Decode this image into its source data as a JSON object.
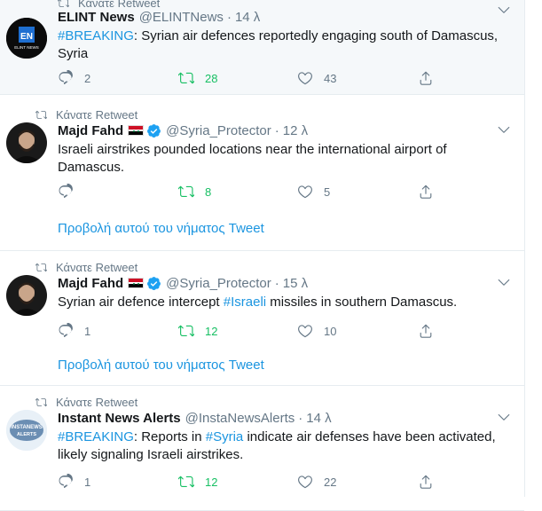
{
  "retweet_label": "Κάνατε Retweet",
  "show_thread": "Προβολή αυτού του νήματος Tweet",
  "dot": "·",
  "colors": {
    "link": "#1b95e0",
    "retweet_green": "#17bf63",
    "muted": "#657786",
    "text": "#14171a",
    "verified": "#1da1f2"
  },
  "tweets": [
    {
      "retweeted": "Κάνατε Retweet",
      "name": "ELINT News",
      "handle": "@ELINTNews",
      "time": "14 λ",
      "hashtag": "#BREAKING",
      "text_after": ": Syrian air defences reportedly engaging south of Damascus, Syria",
      "replies": "2",
      "retweets": "28",
      "likes": "43",
      "avatar_text": "EN",
      "avatar_sub": "ELINT NEWS"
    },
    {
      "retweeted": "Κάνατε Retweet",
      "name": "Majd Fahd",
      "handle": "@Syria_Protector",
      "time": "12 λ",
      "text": "Israeli airstrikes pounded locations near the international airport of Damascus.",
      "replies": "",
      "retweets": "8",
      "likes": "5"
    },
    {
      "retweeted": "Κάνατε Retweet",
      "name": "Majd Fahd",
      "handle": "@Syria_Protector",
      "time": "15 λ",
      "text_before": "Syrian air defence intercept ",
      "hashtag": "#Israeli",
      "text_after": " missiles in southern Damascus.",
      "replies": "1",
      "retweets": "12",
      "likes": "10"
    },
    {
      "retweeted": "Κάνατε Retweet",
      "name": "Instant News Alerts",
      "handle": "@InstaNewsAlerts",
      "time": "14 λ",
      "hashtag1": "#BREAKING",
      "text_mid": ": Reports in ",
      "hashtag2": "#Syria",
      "text_after": " indicate air defenses have been activated, likely signaling Israeli airstrikes.",
      "replies": "1",
      "retweets": "12",
      "likes": "22",
      "avatar_text": "INSTANEWS",
      "avatar_sub": "ALERTS"
    }
  ]
}
